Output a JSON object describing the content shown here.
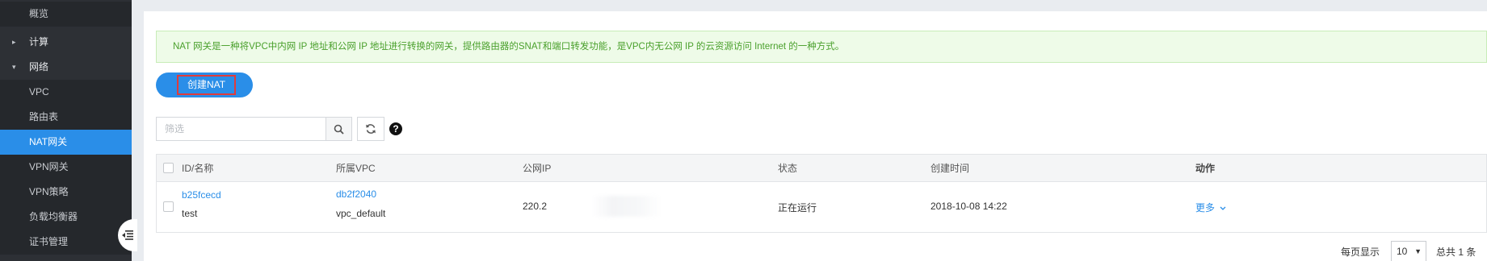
{
  "sidebar": {
    "items": [
      {
        "label": "概览",
        "type": "sub"
      },
      {
        "label": "计算",
        "type": "group",
        "arrow": "▸"
      },
      {
        "label": "网络",
        "type": "group",
        "arrow": "▾"
      },
      {
        "label": "VPC",
        "type": "sub"
      },
      {
        "label": "路由表",
        "type": "sub"
      },
      {
        "label": "NAT网关",
        "type": "sub",
        "active": true
      },
      {
        "label": "VPN网关",
        "type": "sub"
      },
      {
        "label": "VPN策略",
        "type": "sub"
      },
      {
        "label": "负载均衡器",
        "type": "sub"
      },
      {
        "label": "证书管理",
        "type": "sub"
      }
    ]
  },
  "notice": "NAT 网关是一种将VPC中内网 IP 地址和公网 IP 地址进行转换的网关，提供路由器的SNAT和端口转发功能，是VPC内无公网 IP 的云资源访问 Internet 的一种方式。",
  "toolbar": {
    "create_label": "创建NAT",
    "filter_placeholder": "筛选",
    "help_label": "?"
  },
  "table": {
    "columns": [
      "ID/名称",
      "所属VPC",
      "公网IP",
      "状态",
      "创建时间",
      "动作"
    ],
    "rows": [
      {
        "id": "b25fcecd",
        "name": "test",
        "vpc_id": "db2f2040",
        "vpc_name": "vpc_default",
        "public_ip": "220.2",
        "status": "正在运行",
        "created": "2018-10-08 14:22",
        "action": "更多"
      }
    ]
  },
  "pagination": {
    "per_page_label": "每页显示",
    "per_page_value": "10",
    "total_label": "总共 1 条"
  },
  "colors": {
    "accent": "#2a8ee8",
    "sidebar_bg": "#2d3035",
    "notice_text": "#4aa02c"
  }
}
